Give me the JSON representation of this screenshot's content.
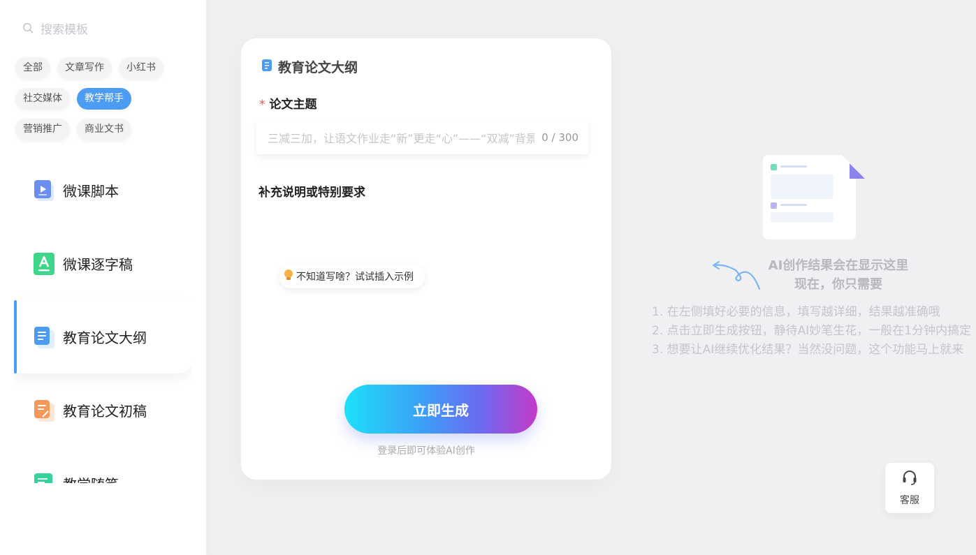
{
  "sidebar": {
    "search_placeholder": "搜索模板",
    "tag_rows": [
      [
        {
          "label": "全部",
          "active": false
        },
        {
          "label": "文章写作",
          "active": false
        },
        {
          "label": "小红书",
          "active": false
        }
      ],
      [
        {
          "label": "社交媒体",
          "active": false
        },
        {
          "label": "教学帮手",
          "active": true
        }
      ],
      [
        {
          "label": "营销推广",
          "active": false
        },
        {
          "label": "商业文书",
          "active": false
        }
      ]
    ],
    "tools": [
      {
        "label": "微课脚本",
        "icon": "video-doc-icon",
        "color": "#6a8ef2",
        "active": false
      },
      {
        "label": "微课逐字稿",
        "icon": "letter-a-icon",
        "color": "#3ed68a",
        "active": false
      },
      {
        "label": "教育论文大纲",
        "icon": "outline-doc-icon",
        "color": "#4d9cf3",
        "active": true
      },
      {
        "label": "教育论文初稿",
        "icon": "draft-doc-icon",
        "color": "#f7995a",
        "active": false
      },
      {
        "label": "教学随笔",
        "icon": "note-doc-icon",
        "color": "#34d39a",
        "active": false
      }
    ]
  },
  "form": {
    "title": "教育论文大纲",
    "topic_label": "论文主题",
    "required_mark": "*",
    "topic_placeholder": "三减三加，让语文作业走“新”更走“心”——“双减”背景下初中语文作业设计的实践探索",
    "topic_count": "0 / 300",
    "extra_label": "补充说明或特别要求",
    "hint_button": "不知道写啥？试试插入示例",
    "generate_button": "立即生成",
    "login_tip": "登录后即可体验AI创作"
  },
  "result": {
    "title_line1": "AI创作结果会在显示这里",
    "title_line2": "现在，你只需要",
    "steps": [
      "1. 在左侧填好必要的信息，填写越详细，结果越准确哦",
      "2. 点击立即生成按钮，静待AI妙笔生花，一般在1分钟内搞定",
      "3. 想要让AI继续优化结果？当然没问题，这个功能马上就来"
    ]
  },
  "service": {
    "label": "客服"
  },
  "colors": {
    "accent": "#4d9cf3",
    "required": "#f05050"
  }
}
